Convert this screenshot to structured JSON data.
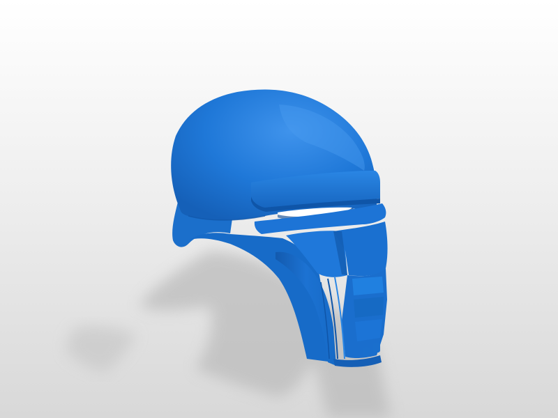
{
  "scene": {
    "subject": "helmet-3d-model",
    "model_color": "#1a74d4",
    "background_color": "#ffffff",
    "floor_color": "#dcdcdc",
    "shadow_color": "#b4b4b4"
  }
}
